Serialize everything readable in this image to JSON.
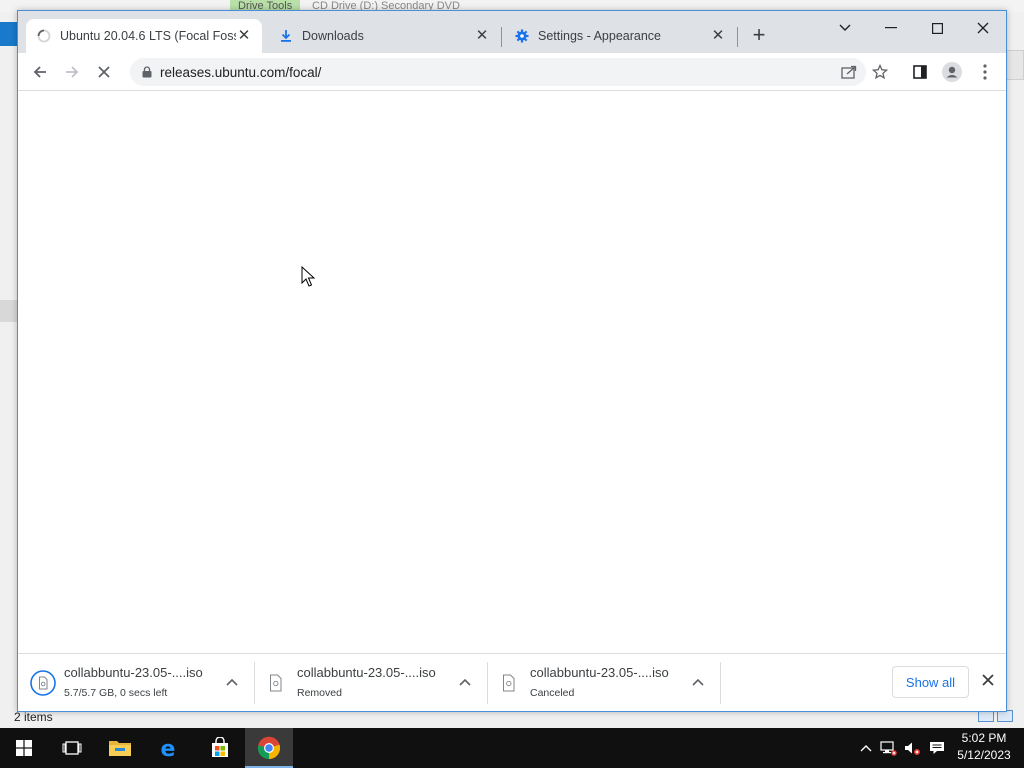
{
  "background": {
    "ribbon_tab": "Drive Tools",
    "window_title": "CD Drive (D:) Secondary DVD",
    "status_text": "2 items"
  },
  "browser": {
    "tabs": [
      {
        "title": "Ubuntu 20.04.6 LTS (Focal Fossa)",
        "favicon": "loading-spinner-icon",
        "active": true
      },
      {
        "title": "Downloads",
        "favicon": "download-icon",
        "active": false
      },
      {
        "title": "Settings - Appearance",
        "favicon": "gear-icon",
        "active": false
      }
    ],
    "address": "releases.ubuntu.com/focal/",
    "accent_color": "#1a73e8"
  },
  "downloads": {
    "items": [
      {
        "name": "collabbuntu-23.05-....iso",
        "status": "5.7/5.7 GB, 0 secs left"
      },
      {
        "name": "collabbuntu-23.05-....iso",
        "status": "Removed"
      },
      {
        "name": "collabbuntu-23.05-....iso",
        "status": "Canceled"
      }
    ],
    "show_all_label": "Show all"
  },
  "taskbar": {
    "apps": [
      "start-icon",
      "task-view-icon",
      "file-explorer-icon",
      "edge-icon",
      "store-icon",
      "chrome-icon"
    ],
    "time": "5:02 PM",
    "date": "5/12/2023"
  }
}
